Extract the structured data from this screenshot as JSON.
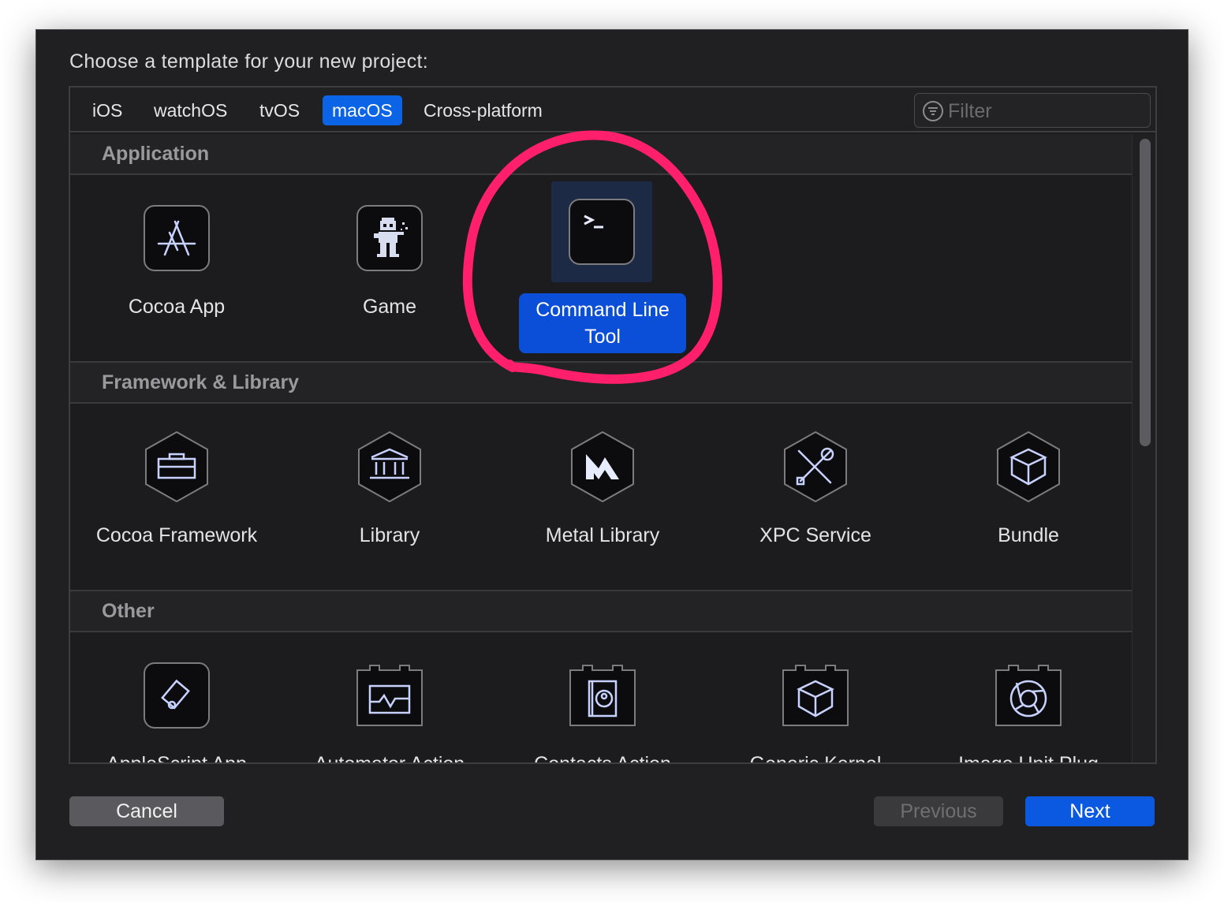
{
  "dialog": {
    "heading": "Choose a template for your new project:"
  },
  "tabs": [
    {
      "label": "iOS",
      "active": false
    },
    {
      "label": "watchOS",
      "active": false
    },
    {
      "label": "tvOS",
      "active": false
    },
    {
      "label": "macOS",
      "active": true
    },
    {
      "label": "Cross-platform",
      "active": false
    }
  ],
  "filter": {
    "placeholder": "Filter",
    "value": ""
  },
  "sections": [
    {
      "title": "Application",
      "items": [
        {
          "label": "Cocoa App",
          "icon": "app-store-icon",
          "selected": false
        },
        {
          "label": "Game",
          "icon": "game-sprite-icon",
          "selected": false
        },
        {
          "label": "Command Line Tool",
          "icon": "terminal-icon",
          "selected": true
        }
      ]
    },
    {
      "title": "Framework & Library",
      "items": [
        {
          "label": "Cocoa Framework",
          "icon": "toolbox-icon"
        },
        {
          "label": "Library",
          "icon": "library-building-icon"
        },
        {
          "label": "Metal Library",
          "icon": "metal-icon"
        },
        {
          "label": "XPC Service",
          "icon": "tools-icon"
        },
        {
          "label": "Bundle",
          "icon": "cube-icon"
        }
      ]
    },
    {
      "title": "Other",
      "items": [
        {
          "label": "AppleScript App",
          "icon": "applescript-icon"
        },
        {
          "label": "Automator Action",
          "icon": "automator-icon"
        },
        {
          "label": "Contacts Action",
          "icon": "contacts-icon"
        },
        {
          "label": "Generic Kernel",
          "icon": "kernel-icon"
        },
        {
          "label": "Image Unit Plug",
          "icon": "aperture-icon"
        }
      ]
    }
  ],
  "buttons": {
    "cancel": "Cancel",
    "previous": "Previous",
    "next": "Next"
  },
  "colors": {
    "accent": "#0b63e5",
    "selection": "#0b4fd9",
    "annotation": "#ff1f6a",
    "background": "#202022"
  }
}
